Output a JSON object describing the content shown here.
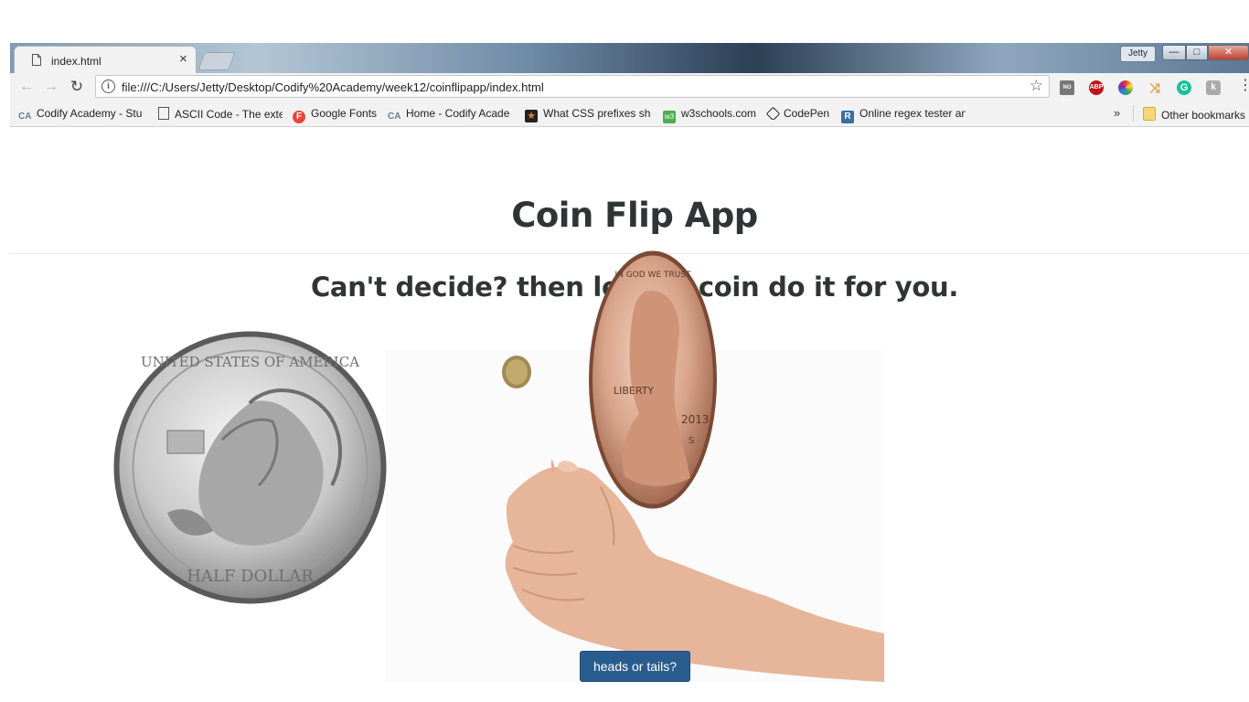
{
  "browser": {
    "tab_title": "index.html",
    "tab_close": "×",
    "profile_name": "Jetty",
    "url": "file:///C:/Users/Jetty/Desktop/Codify%20Academy/week12/coinflipapp/index.html",
    "extensions": [
      "no-ads-icon",
      "adblock-plus-icon",
      "color-picker-icon",
      "pin-icon",
      "grammarly-icon",
      "k-icon"
    ],
    "extension_labels": {
      "abp": "ABP",
      "grammarly": "G"
    },
    "bookmarks": [
      {
        "label": "Codify Academy - Stu",
        "icon": "ca-icon"
      },
      {
        "label": "ASCII Code - The exte",
        "icon": "document-icon"
      },
      {
        "label": "Google Fonts",
        "icon": "google-fonts-icon"
      },
      {
        "label": "Home - Codify Acade",
        "icon": "ca-icon"
      },
      {
        "label": "What CSS prefixes sho",
        "icon": "star-icon"
      },
      {
        "label": "w3schools.com",
        "icon": "w3schools-icon"
      },
      {
        "label": "CodePen",
        "icon": "codepen-icon"
      },
      {
        "label": "Online regex tester an",
        "icon": "regex-icon"
      }
    ],
    "bookmarks_overflow": "»",
    "other_bookmarks": "Other bookmarks"
  },
  "page": {
    "title": "Coin Flip App",
    "subtitle": "Can't decide? then let the coin do it for you.",
    "button_label": "heads or tails?"
  },
  "colors": {
    "heading": "#2f3435",
    "button_bg": "#2a5d8f",
    "button_text": "#ffffff"
  }
}
